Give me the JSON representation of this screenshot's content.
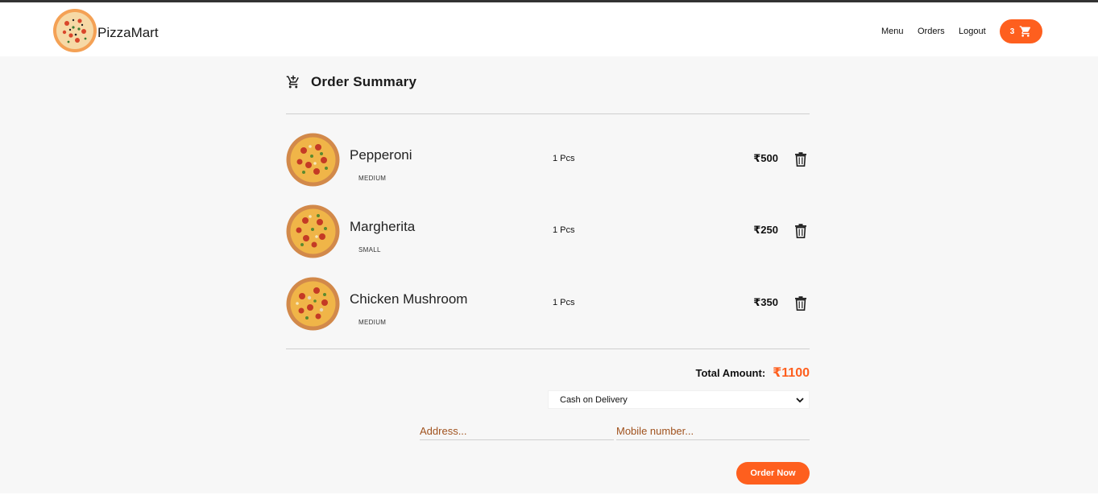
{
  "header": {
    "brand": "PizzaMart",
    "logo_icon": "pizza-logo-icon",
    "nav": [
      "Menu",
      "Orders",
      "Logout"
    ],
    "cart_count": "3",
    "cart_icon": "cart-icon"
  },
  "summary": {
    "title": "Order Summary",
    "title_icon": "cart-plus-icon",
    "items": [
      {
        "name": "Pepperoni",
        "size": "MEDIUM",
        "qty": "1 Pcs",
        "price": "₹500"
      },
      {
        "name": "Margherita",
        "size": "SMALL",
        "qty": "1 Pcs",
        "price": "₹250"
      },
      {
        "name": "Chicken Mushroom",
        "size": "MEDIUM",
        "qty": "1 Pcs",
        "price": "₹350"
      }
    ],
    "total_label": "Total Amount:",
    "total_value": "₹1100",
    "payment_selected": "Cash on Delivery",
    "address_placeholder": "Address...",
    "mobile_placeholder": "Mobile number...",
    "order_button": "Order Now"
  },
  "colors": {
    "accent": "#fe5f1e",
    "background": "#f7f7f7",
    "header_bg": "#ffffff",
    "placeholder": "#a0521e"
  }
}
